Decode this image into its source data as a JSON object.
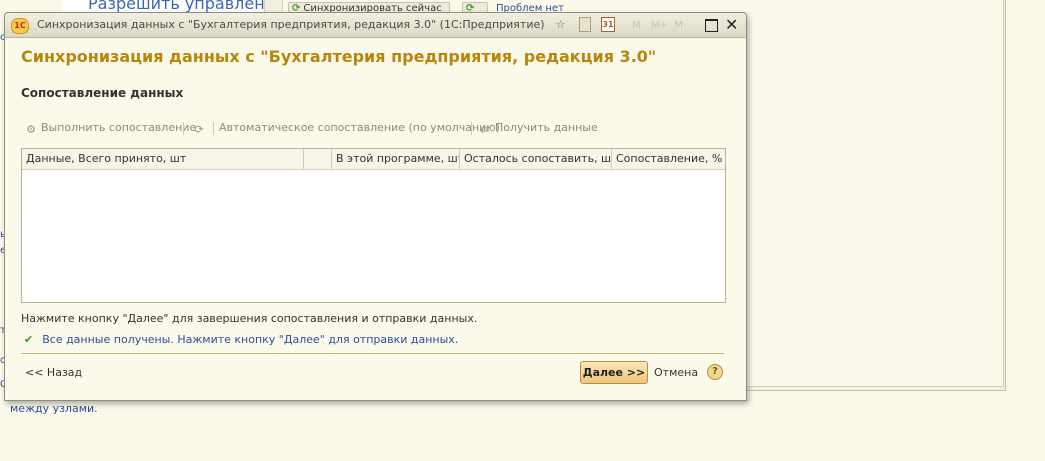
{
  "background": {
    "link_text": "Разрешить управлен",
    "sync_button": "Синхронизировать сейчас",
    "problems_link": "Проблем нет",
    "bottom_text": "между узлами.",
    "left_fragments": [
      "с",
      "ы",
      "е",
      "т",
      "с",
      "С"
    ]
  },
  "window": {
    "title": "Синхронизация данных с \"Бухгалтерия предприятия, редакция 3.0\"  (1С:Предприятие)",
    "controls": {
      "favorites": "☆",
      "calendar": "31",
      "m": "M",
      "m_plus": "M+",
      "m_minus": "M-",
      "close": "✕"
    }
  },
  "dialog": {
    "heading": "Синхронизация данных с \"Бухгалтерия предприятия, редакция 3.0\"",
    "section": "Сопоставление данных",
    "toolbar": {
      "run_matching": "Выполнить сопоставление",
      "auto_matching": "Автоматическое сопоставление (по умолчанию)",
      "get_data": "Получить данные"
    },
    "table": {
      "columns": [
        "Данные, Всего принято, шт",
        "",
        "В этой программе, шт",
        "Осталось сопоставить, шт",
        "Сопоставление, %"
      ],
      "rows": []
    },
    "hint": "Нажмите кнопку \"Далее\" для завершения сопоставления и отправки данных.",
    "status": "Все данные получены. Нажмите кнопку \"Далее\" для отправки данных.",
    "buttons": {
      "back": "<< Назад",
      "next": "Далее >>",
      "cancel": "Отмена",
      "help": "?"
    }
  }
}
